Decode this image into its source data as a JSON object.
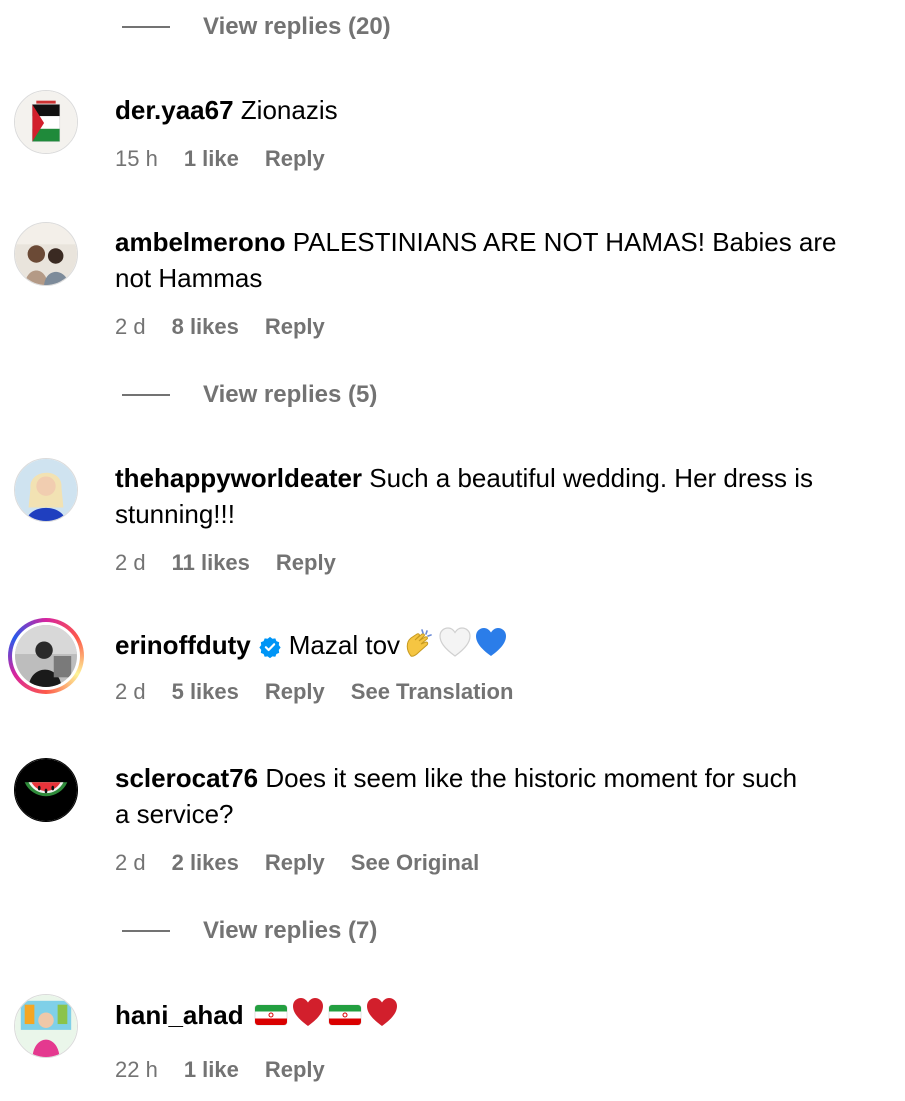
{
  "comments": [
    {
      "username": "der.yaa67",
      "text": "Zionazis",
      "time": "15 h",
      "likes": "1 like",
      "reply": "Reply"
    },
    {
      "username": "ambelmerono",
      "text": "PALESTINIANS ARE NOT HAMAS! Babies are",
      "text2": "not Hammas",
      "time": "2 d",
      "likes": "8 likes",
      "reply": "Reply"
    },
    {
      "username": "thehappyworldeater",
      "text": "Such a beautiful wedding. Her dress is",
      "text2": "stunning!!!",
      "time": "2 d",
      "likes": "11 likes",
      "reply": "Reply"
    },
    {
      "username": "erinoffduty",
      "text": "Mazal tov",
      "time": "2 d",
      "likes": "5 likes",
      "reply": "Reply",
      "extra": "See Translation"
    },
    {
      "username": "sclerocat76",
      "text": "Does it seem like the historic moment for such",
      "text2": "a service?",
      "time": "2 d",
      "likes": "2 likes",
      "reply": "Reply",
      "extra": "See Original"
    },
    {
      "username": "hani_ahad",
      "text": "",
      "time": "22 h",
      "likes": "1 like",
      "reply": "Reply"
    }
  ],
  "view_replies": [
    "View replies (20)",
    "View replies (5)",
    "View replies (7)"
  ],
  "colors": {
    "secondary_text": "#737373",
    "verified_badge": "#0095f6",
    "heart_red": "#d21f2c",
    "heart_blue": "#2b7de9"
  }
}
